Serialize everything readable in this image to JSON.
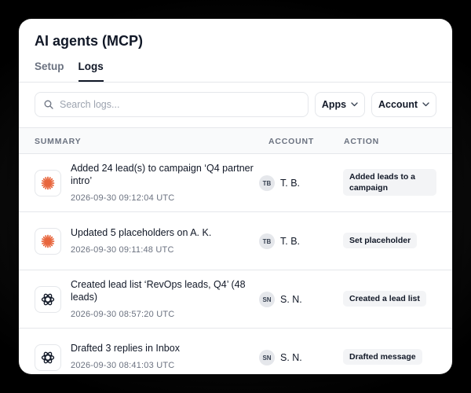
{
  "page": {
    "title": "AI agents (MCP)"
  },
  "tabs": [
    {
      "label": "Setup",
      "active": false
    },
    {
      "label": "Logs",
      "active": true
    }
  ],
  "filters": {
    "search_placeholder": "Search logs...",
    "search_value": "",
    "apps_label": "Apps",
    "account_label": "Account"
  },
  "table": {
    "columns": {
      "summary": "SUMMARY",
      "account": "ACCOUNT",
      "action": "ACTION"
    },
    "rows": [
      {
        "app_icon": "sparkle-asterisk-icon",
        "summary": "Added 24 lead(s) to campaign ‘Q4 partner intro’",
        "time": "2026-09-30 09:12:04 UTC",
        "initials": "TB",
        "account": "T. B.",
        "action": "Added leads to a campaign"
      },
      {
        "app_icon": "sparkle-asterisk-icon",
        "summary": "Updated 5 placeholders on A. K.",
        "time": "2026-09-30 09:11:48 UTC",
        "initials": "TB",
        "account": "T. B.",
        "action": "Set placeholder"
      },
      {
        "app_icon": "openai-knot-icon",
        "summary": "Created lead list ‘RevOps leads, Q4’ (48 leads)",
        "time": "2026-09-30 08:57:20 UTC",
        "initials": "SN",
        "account": "S. N.",
        "action": "Created a lead list"
      },
      {
        "app_icon": "openai-knot-icon",
        "summary": "Drafted 3 replies in Inbox",
        "time": "2026-09-30 08:41:03 UTC",
        "initials": "SN",
        "account": "S. N.",
        "action": "Drafted message"
      }
    ]
  },
  "colors": {
    "accent": "#e8663d",
    "page_bg": "#000000",
    "panel_bg": "#ffffff",
    "muted_text": "#6b7280",
    "border": "#e5e7eb"
  }
}
